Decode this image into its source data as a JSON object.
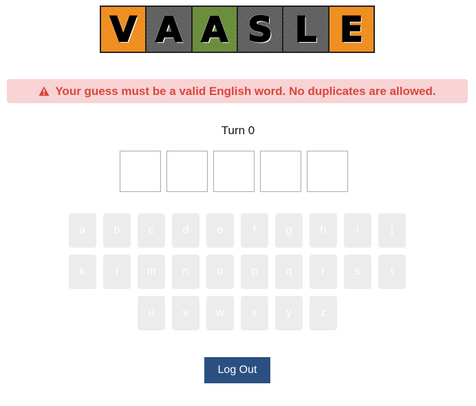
{
  "logo": {
    "letters": [
      {
        "char": "V",
        "color": "#f4901e"
      },
      {
        "char": "A",
        "color": "#616161"
      },
      {
        "char": "A",
        "color": "#6a8f3a"
      },
      {
        "char": "S",
        "color": "#616161"
      },
      {
        "char": "L",
        "color": "#616161"
      },
      {
        "char": "E",
        "color": "#f4901e"
      }
    ]
  },
  "alert": {
    "icon": "warning-icon",
    "message": "Your guess must be a valid English word. No duplicates are allowed.",
    "color": "#d9463b",
    "background": "#f8d3d3"
  },
  "turn": {
    "label": "Turn 0"
  },
  "guess": {
    "slots": [
      "",
      "",
      "",
      "",
      ""
    ]
  },
  "keyboard": {
    "rows": [
      [
        "a",
        "b",
        "c",
        "d",
        "e",
        "f",
        "g",
        "h",
        "i",
        "j"
      ],
      [
        "k",
        "l",
        "m",
        "n",
        "o",
        "p",
        "q",
        "r",
        "s",
        "t"
      ],
      [
        "u",
        "v",
        "w",
        "x",
        "y",
        "z"
      ]
    ]
  },
  "actions": {
    "logout_label": "Log Out",
    "logout_color": "#2a5082"
  }
}
